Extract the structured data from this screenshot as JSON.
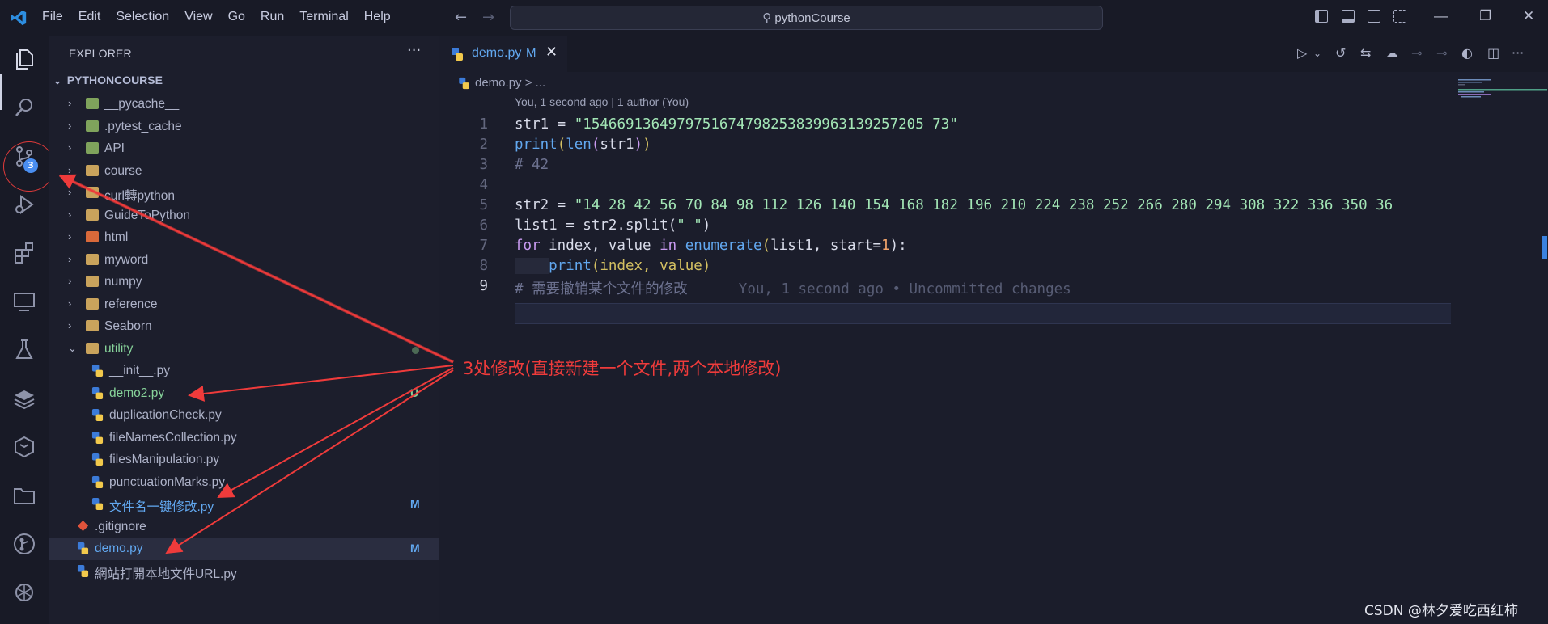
{
  "menu": [
    "File",
    "Edit",
    "Selection",
    "View",
    "Go",
    "Run",
    "Terminal",
    "Help"
  ],
  "search": {
    "text": "pythonCourse"
  },
  "explorer": {
    "title": "EXPLORER",
    "root": "PYTHONCOURSE",
    "items": [
      {
        "label": "__pycache__",
        "color": "#aeb3c9"
      },
      {
        "label": ".pytest_cache",
        "color": "#aeb3c9"
      },
      {
        "label": "API",
        "color": "#aeb3c9"
      },
      {
        "label": "course",
        "color": "#aeb3c9"
      },
      {
        "label": "curl轉python",
        "color": "#aeb3c9"
      },
      {
        "label": "GuideToPython",
        "color": "#aeb3c9"
      },
      {
        "label": "html",
        "color": "#aeb3c9"
      },
      {
        "label": "myword",
        "color": "#aeb3c9"
      },
      {
        "label": "numpy",
        "color": "#aeb3c9"
      },
      {
        "label": "reference",
        "color": "#aeb3c9"
      },
      {
        "label": "Seaborn",
        "color": "#aeb3c9"
      },
      {
        "label": "utility",
        "color": "#87d39a"
      },
      {
        "label": "__init__.py",
        "color": "#aeb3c9"
      },
      {
        "label": "demo2.py",
        "color": "#87d39a",
        "status": "U"
      },
      {
        "label": "duplicationCheck.py",
        "color": "#aeb3c9"
      },
      {
        "label": "fileNamesCollection.py",
        "color": "#aeb3c9"
      },
      {
        "label": "filesManipulation.py",
        "color": "#aeb3c9"
      },
      {
        "label": "punctuationMarks.py",
        "color": "#aeb3c9"
      },
      {
        "label": "文件名一键修改.py",
        "color": "#62a8f0",
        "status": "M"
      },
      {
        "label": ".gitignore",
        "color": "#aeb3c9"
      },
      {
        "label": "demo.py",
        "color": "#62a8f0",
        "status": "M"
      },
      {
        "label": "網站打開本地文件URL.py",
        "color": "#aeb3c9"
      }
    ]
  },
  "scm_badge": "3",
  "tab": {
    "label": "demo.py",
    "modified": "M",
    "close": "✕"
  },
  "breadcrumb": "demo.py > ...",
  "blame_header": "You, 1 second ago | 1 author (You)",
  "line_numbers": [
    "1",
    "2",
    "3",
    "4",
    "5",
    "6",
    "7",
    "8",
    "9"
  ],
  "code": {
    "l1_a": "str1 = ",
    "l1_b": "\"1546691364979751674798253839963139257205 73\"",
    "l2_a": "print",
    "l2_b": "(",
    "l2_c": "len",
    "l2_d": "(",
    "l2_e": "str1",
    "l2_f": ")",
    "l2_g": ")",
    "l3": "# 42",
    "l5_a": "str2 = ",
    "l5_b": "\"14 28 42 56 70 84 98 112 126 140 154 168 182 196 210 224 238 252 266 280 294 308 322 336 350 36",
    "l6_a": "list1 = str2.split(",
    "l6_b": "\" \"",
    "l6_c": ")",
    "l7_a": "for",
    "l7_b": " index, value ",
    "l7_c": "in",
    "l7_d": " ",
    "l7_e": "enumerate",
    "l7_f": "(",
    "l7_g": "list1, start=",
    "l7_h": "1",
    "l7_i": "):",
    "l8_a": "print",
    "l8_b": "(index, value)",
    "l9_a": "# 需要撤销某个文件的修改",
    "l9_b": "You, 1 second ago • Uncommitted changes"
  },
  "annotation": "3处修改(直接新建一个文件,两个本地修改)",
  "watermark": "CSDN @林夕爱吃西红柿",
  "colors": {
    "accent": "#3c7bd8",
    "annotation": "#ef3b3b",
    "modified": "#62a8f0",
    "untracked": "#87d39a"
  }
}
